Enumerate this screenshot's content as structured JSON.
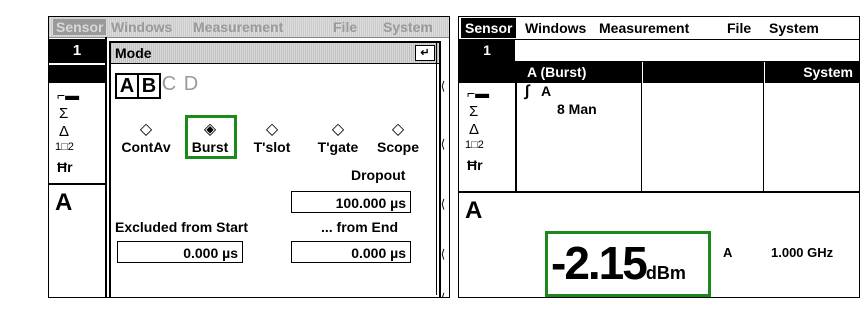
{
  "screen1": {
    "menu": [
      "Sensor",
      "Windows",
      "Measurement",
      "File",
      "System"
    ],
    "channel": "1",
    "dialog_title": "Mode",
    "enter_glyph": "↵",
    "channels": [
      "A",
      "B",
      "C",
      "D"
    ],
    "modes": [
      {
        "label": "ContAv",
        "glyph": "◇"
      },
      {
        "label": "Burst",
        "glyph": "◈"
      },
      {
        "label": "T'slot",
        "glyph": "◇"
      },
      {
        "label": "T'gate",
        "glyph": "◇"
      },
      {
        "label": "Scope",
        "glyph": "◇"
      }
    ],
    "dropout_label": "Dropout",
    "dropout_value": "100.000 µs",
    "excluded_start_label": "Excluded from Start",
    "excluded_start_value": "0.000 µs",
    "from_end_label": "... from End",
    "from_end_value": "0.000 µs",
    "left_symbols": [
      "Σ",
      "Δ",
      "1□2",
      "Ħr"
    ],
    "big_label": "A"
  },
  "screen2": {
    "menu": [
      "Sensor",
      "Windows",
      "Measurement",
      "File",
      "System"
    ],
    "channel": "1",
    "header_a": "A (Burst)",
    "header_system": "System",
    "trace_glyph": "∫",
    "trace_label": "A",
    "man_text": "8 Man",
    "left_symbols": [
      "Σ",
      "Δ",
      "1□2",
      "Ħr"
    ],
    "big_label": "A",
    "reading": "-2.15",
    "reading_unit": "dBm",
    "channel_letter": "A",
    "frequency": "1.000 GHz"
  },
  "colors": {
    "highlight": "#1a8a1a",
    "inactive": "#9a9a9a"
  }
}
